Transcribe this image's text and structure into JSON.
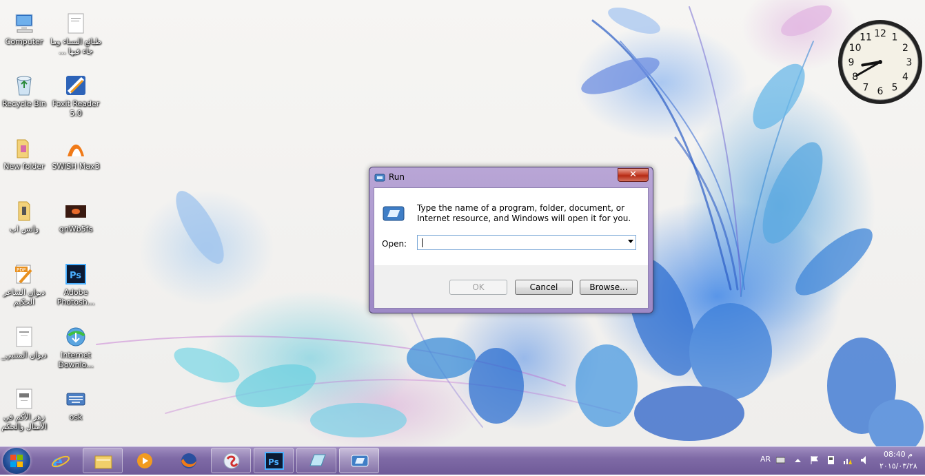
{
  "desktop_icons": [
    {
      "name": "computer",
      "label": "Computer"
    },
    {
      "name": "arabic-doc-1",
      "label": "طبائع النساء وما جاء فيها ..."
    },
    {
      "name": "recycle-bin",
      "label": "Recycle Bin"
    },
    {
      "name": "foxit-reader",
      "label": "Foxit Reader 5.0"
    },
    {
      "name": "new-folder",
      "label": "New folder"
    },
    {
      "name": "swish-max",
      "label": "SWiSH Max3"
    },
    {
      "name": "whatsapp-folder",
      "label": "واتس اب"
    },
    {
      "name": "qnwb5fs",
      "label": "qnWb5fs"
    },
    {
      "name": "pdf-diwan",
      "label": "ديوان الشاعر الحكيم"
    },
    {
      "name": "adobe-photoshop",
      "label": "Adobe Photosh..."
    },
    {
      "name": "diwan-mutanabbi",
      "label": "ديوان المتنبي_"
    },
    {
      "name": "internet-download",
      "label": "Internet Downlo..."
    },
    {
      "name": "zahr-alakam",
      "label": "زهر الأكم في الأمثال والحكم"
    },
    {
      "name": "osk",
      "label": "osk"
    }
  ],
  "run_dialog": {
    "title": "Run",
    "close_glyph": "✕",
    "message": "Type the name of a program, folder, document, or Internet resource, and Windows will open it for you.",
    "open_label": "Open:",
    "open_value": "",
    "ok_label": "OK",
    "cancel_label": "Cancel",
    "browse_label": "Browse..."
  },
  "clock": {
    "numerals": [
      "12",
      "1",
      "2",
      "3",
      "4",
      "5",
      "6",
      "7",
      "8",
      "9",
      "10",
      "11"
    ],
    "hour": 8,
    "minute": 40
  },
  "taskbar": {
    "items": [
      "internet-explorer-icon",
      "file-explorer-icon",
      "media-player-icon",
      "firefox-icon",
      "app-icon",
      "photoshop-icon",
      "notepad-icon",
      "run-icon"
    ],
    "language": "AR",
    "time": "08:40 م",
    "date": "٢٠١٥/٠٣/٢٨"
  },
  "colors": {
    "taskbar": "#7f6aa6",
    "dialog_frame": "#b9a6d6",
    "close": "#c7452f"
  }
}
